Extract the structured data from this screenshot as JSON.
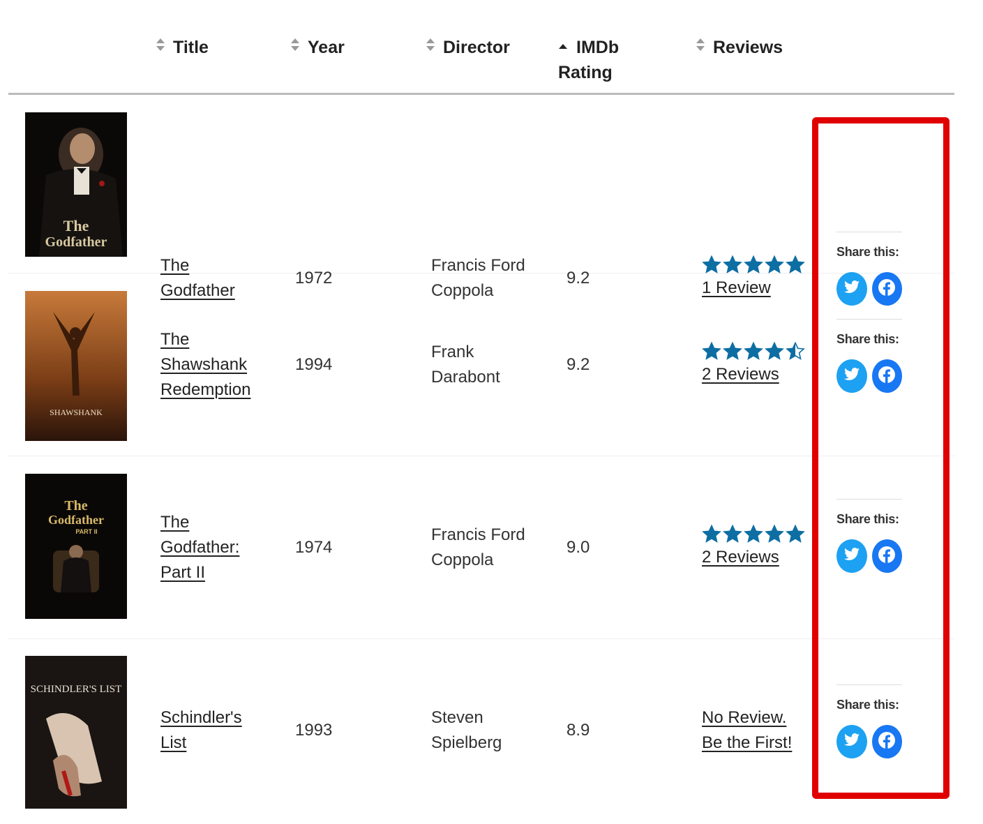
{
  "columns": {
    "title": "Title",
    "year": "Year",
    "director": "Director",
    "rating": "IMDb\nRating",
    "reviews": "Reviews"
  },
  "share_title": "Share this:",
  "colors": {
    "star": "#0d6ea3",
    "twitter": "#1da1f2",
    "facebook": "#1877f2",
    "highlight": "#e00000"
  },
  "movies": [
    {
      "title_lines": [
        "The",
        "Godfather"
      ],
      "year": "1972",
      "director_lines": [
        "Francis Ford",
        "Coppola"
      ],
      "rating": "9.2",
      "stars": 5,
      "reviews_lines": [
        "1 Review"
      ],
      "poster": "the-godfather-poster"
    },
    {
      "title_lines": [
        "The",
        "Shawshank",
        "Redemption"
      ],
      "year": "1994",
      "director_lines": [
        "Frank",
        "Darabont"
      ],
      "rating": "9.2",
      "stars": 4.5,
      "reviews_lines": [
        "2 Reviews"
      ],
      "poster": "shawshank-redemption-poster",
      "poster_text": "SHAWSHANK"
    },
    {
      "title_lines": [
        "The",
        "Godfather:",
        "Part II"
      ],
      "year": "1974",
      "director_lines": [
        "Francis Ford",
        "Coppola"
      ],
      "rating": "9.0",
      "stars": 5,
      "reviews_lines": [
        "2 Reviews"
      ],
      "poster": "godfather-part-ii-poster"
    },
    {
      "title_lines": [
        "Schindler's",
        "List"
      ],
      "year": "1993",
      "director_lines": [
        "Steven",
        "Spielberg"
      ],
      "rating": "8.9",
      "stars": 0,
      "reviews_lines": [
        "No Review.",
        "Be the First!"
      ],
      "poster": "schindlers-list-poster",
      "poster_text": "SCHINDLER'S LIST"
    }
  ]
}
